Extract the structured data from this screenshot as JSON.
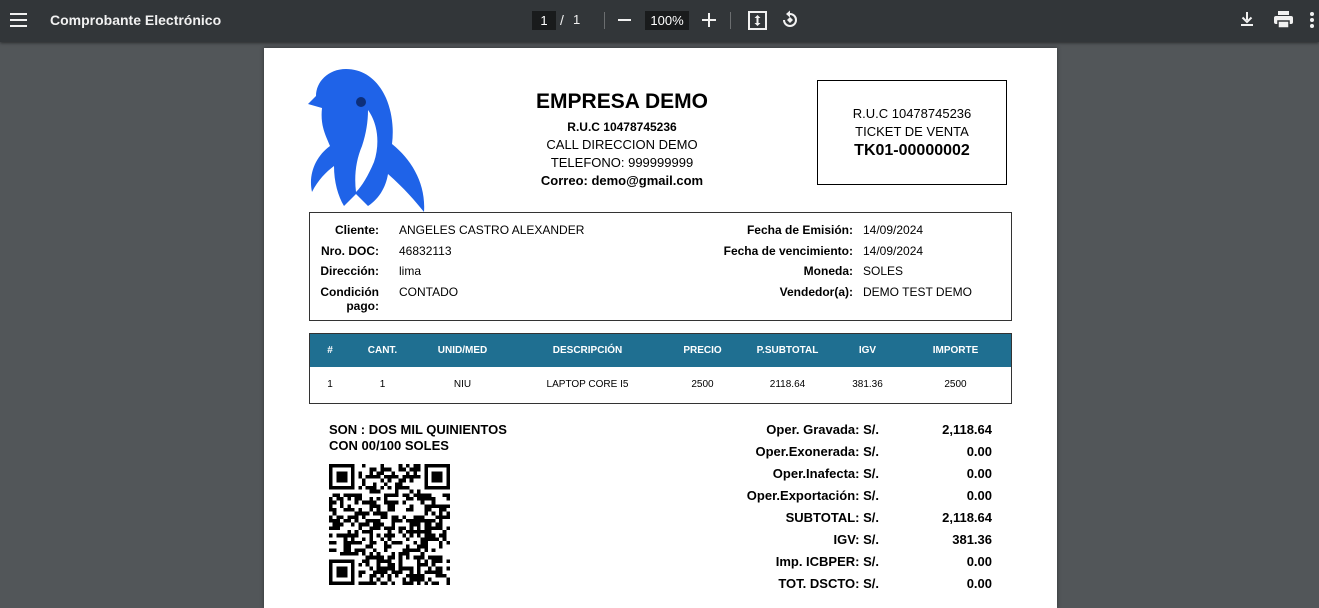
{
  "viewer": {
    "title": "Comprobante Electrónico",
    "page_current": "1",
    "page_separator": "/",
    "page_total": "1",
    "zoom": "100%",
    "icons": [
      "menu-icon",
      "zoom-out-icon",
      "zoom-in-icon",
      "fit-page-icon",
      "rotate-icon",
      "download-icon",
      "print-icon",
      "more-icon"
    ]
  },
  "company": {
    "name": "EMPRESA DEMO",
    "ruc": "R.U.C 10478745236",
    "address": "CALL DIRECCION DEMO",
    "phone": "TELEFONO: 999999999",
    "email": "Correo: demo@gmail.com",
    "logo_color": "#1f63e8"
  },
  "ticket": {
    "ruc": "R.U.C 10478745236",
    "type": "TICKET DE VENTA",
    "number": "TK01-00000002"
  },
  "client": {
    "cliente_label": "Cliente:",
    "cliente": "ANGELES CASTRO ALEXANDER",
    "doc_label": "Nro. DOC:",
    "doc": "46832113",
    "direccion_label": "Dirección:",
    "direccion": "lima",
    "condicion_label_1": "Condición",
    "condicion_label_2": "pago:",
    "condicion": "CONTADO",
    "emision_label": "Fecha de Emisión:",
    "emision": "14/09/2024",
    "vencimiento_label": "Fecha de vencimiento:",
    "vencimiento": "14/09/2024",
    "moneda_label": "Moneda:",
    "moneda": "SOLES",
    "vendedor_label": "Vendedor(a):",
    "vendedor": "DEMO TEST DEMO"
  },
  "items": {
    "header_color": "#1f6f91",
    "headers": [
      "#",
      "CANT.",
      "UNID/MED",
      "DESCRIPCIÓN",
      "PRECIO",
      "P.SUBTOTAL",
      "IGV",
      "IMPORTE"
    ],
    "rows": [
      [
        "1",
        "1",
        "NIU",
        "LAPTOP CORE I5",
        "2500",
        "2118.64",
        "381.36",
        "2500"
      ]
    ]
  },
  "son": {
    "line1": "SON : DOS MIL QUINIENTOS",
    "line2": "CON 00/100 SOLES"
  },
  "totals": [
    {
      "label": "Oper. Gravada: S/.",
      "value": "2,118.64"
    },
    {
      "label": "Oper.Exonerada: S/.",
      "value": "0.00"
    },
    {
      "label": "Oper.Inafecta: S/.",
      "value": "0.00"
    },
    {
      "label": "Oper.Exportación: S/.",
      "value": "0.00"
    },
    {
      "label": "SUBTOTAL: S/.",
      "value": "2,118.64"
    },
    {
      "label": "IGV: S/.",
      "value": "381.36"
    },
    {
      "label": "Imp. ICBPER: S/.",
      "value": "0.00"
    },
    {
      "label": "TOT. DSCTO: S/.",
      "value": "0.00"
    }
  ]
}
